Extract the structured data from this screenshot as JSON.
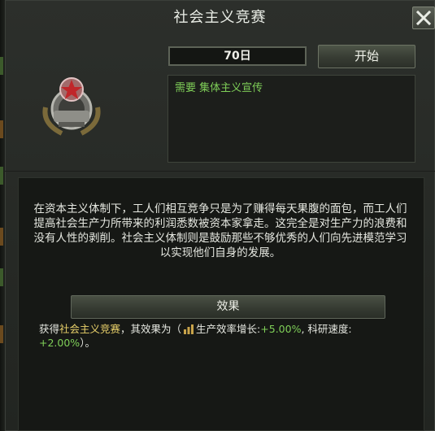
{
  "window": {
    "title": "社会主义竞赛",
    "close_icon": "close-icon"
  },
  "controls": {
    "days_value": "70日",
    "start_label": "开始"
  },
  "requirements": {
    "label": "需要",
    "item": "集体主义宣传"
  },
  "emblem": {
    "icon": "red-star-gear-laurel-emblem-icon"
  },
  "description": "在资本主义体制下，工人们相互竞争只是为了赚得每天果腹的面包，而工人们提高社会生产力所带来的利润悉数被资本家拿走。这完全是对生产力的浪费和没有人性的剥削。社会主义体制则是鼓励那些不够优秀的人们向先进模范学习以实现他们自身的发展。",
  "effect": {
    "header": "效果",
    "prefix": "获得",
    "modifier_name": "社会主义竞赛",
    "middle": "，其效果为（",
    "icon": "production-efficiency-icon",
    "stat1_label": "生产效率增长:",
    "stat1_value": "+5.00%",
    "stat2_label": ", 科研速度:",
    "stat2_value": "+2.00%",
    "suffix": "）。"
  },
  "colors": {
    "accent_green": "#7fcf58",
    "highlight_yellow": "#e9d16a",
    "panel_bg": "#2a2d29"
  }
}
